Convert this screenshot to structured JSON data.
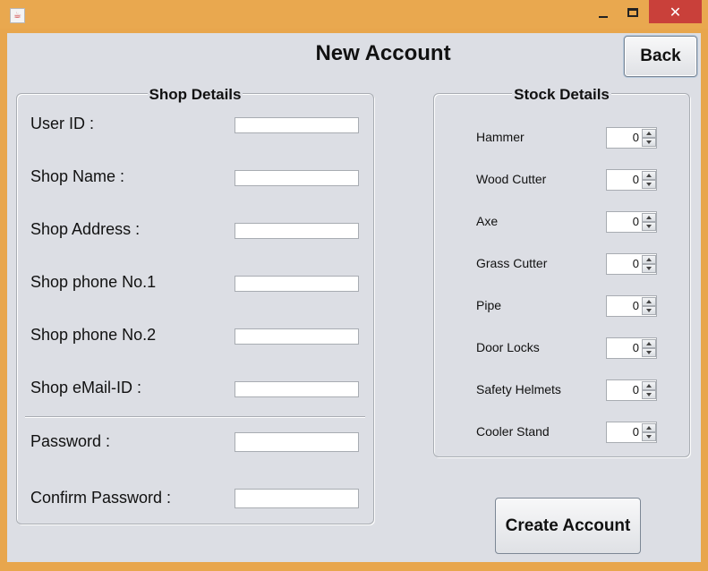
{
  "window": {
    "title": "",
    "minimize": "",
    "maximize": "",
    "close": "✕"
  },
  "header": {
    "title": "New Account",
    "back_label": "Back"
  },
  "shop": {
    "title": "Shop Details",
    "user_id_label": "User ID :",
    "shop_name_label": "Shop Name :",
    "shop_address_label": "Shop Address :",
    "phone1_label": "Shop phone No.1",
    "phone2_label": "Shop phone No.2",
    "email_label": "Shop eMail-ID :",
    "password_label": "Password :",
    "confirm_password_label": "Confirm Password :",
    "user_id_value": "",
    "shop_name_value": "",
    "shop_address_value": "",
    "phone1_value": "",
    "phone2_value": "",
    "email_value": "",
    "password_value": "",
    "confirm_password_value": ""
  },
  "stock": {
    "title": "Stock Details",
    "items": [
      {
        "label": "Hammer",
        "value": "0"
      },
      {
        "label": "Wood Cutter",
        "value": "0"
      },
      {
        "label": "Axe",
        "value": "0"
      },
      {
        "label": "Grass Cutter",
        "value": "0"
      },
      {
        "label": "Pipe",
        "value": "0"
      },
      {
        "label": "Door Locks",
        "value": "0"
      },
      {
        "label": "Safety Helmets",
        "value": "0"
      },
      {
        "label": "Cooler Stand",
        "value": "0"
      }
    ]
  },
  "actions": {
    "create_label": "Create Account"
  },
  "icons": {
    "app": "java-app-icon",
    "minimize": "minimize-icon",
    "maximize": "maximize-icon",
    "close": "close-icon"
  }
}
